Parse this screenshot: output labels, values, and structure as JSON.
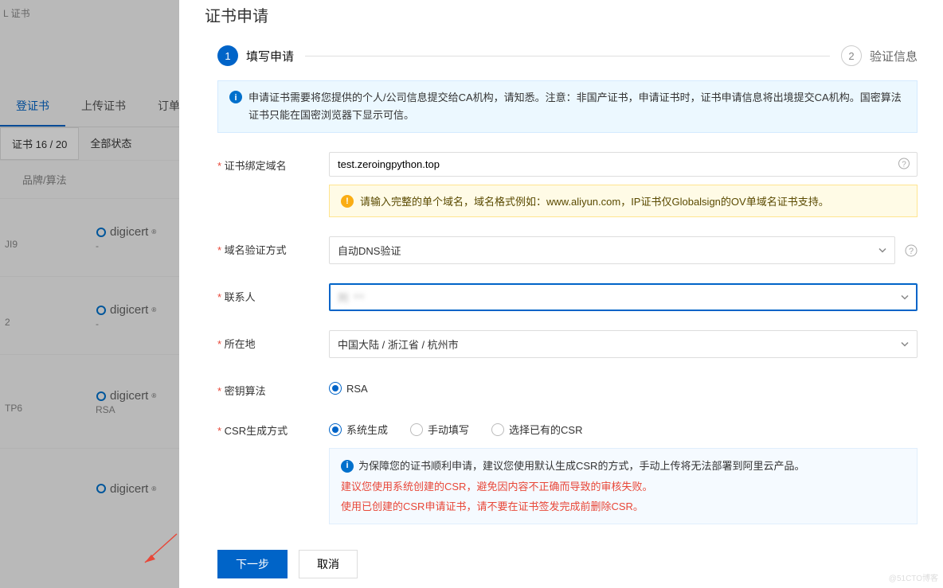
{
  "bg": {
    "breadcrumb": "L 证书",
    "tabs": [
      "登证书",
      "上传证书",
      "订单管"
    ],
    "active_tab": 0,
    "filters": {
      "quota": "证书 16 / 20",
      "status": "全部状态"
    },
    "col_header": "品牌/算法",
    "rows": [
      {
        "id": "JI9",
        "brand": "digicert",
        "algo": "-"
      },
      {
        "id": "2",
        "brand": "digicert",
        "algo": "-"
      },
      {
        "id": "TP6",
        "brand": "digicert",
        "algo": "RSA"
      },
      {
        "id": "",
        "brand": "digicert",
        "algo": ""
      }
    ]
  },
  "panel": {
    "title": "证书申请",
    "steps": {
      "s1": {
        "num": "1",
        "label": "填写申请"
      },
      "s2": {
        "num": "2",
        "label": "验证信息"
      }
    },
    "notice": "申请证书需要将您提供的个人/公司信息提交给CA机构，请知悉。注意：非国产证书，申请证书时，证书申请信息将出境提交CA机构。国密算法证书只能在国密浏览器下显示可信。",
    "fields": {
      "domain": {
        "label": "证书绑定域名",
        "value": "test.zeroingpython.top",
        "hint": "请输入完整的单个域名，域名格式例如：www.aliyun.com，IP证书仅Globalsign的OV单域名证书支持。"
      },
      "verify": {
        "label": "域名验证方式",
        "value": "自动DNS验证"
      },
      "contact": {
        "label": "联系人",
        "value": "刘 **"
      },
      "location": {
        "label": "所在地",
        "value": "中国大陆 / 浙江省 / 杭州市"
      },
      "key_algo": {
        "label": "密钥算法",
        "options": [
          "RSA"
        ],
        "selected": 0
      },
      "csr": {
        "label": "CSR生成方式",
        "options": [
          "系统生成",
          "手动填写",
          "选择已有的CSR"
        ],
        "selected": 0,
        "info": "为保障您的证书顺利申请，建议您使用默认生成CSR的方式，手动上传将无法部署到阿里云产品。",
        "warn1": "建议您使用系统创建的CSR，避免因内容不正确而导致的审核失败。",
        "warn2": "使用已创建的CSR申请证书，请不要在证书签发完成前删除CSR。"
      }
    },
    "footer": {
      "next": "下一步",
      "cancel": "取消"
    }
  },
  "watermark": "@51CTO博客"
}
